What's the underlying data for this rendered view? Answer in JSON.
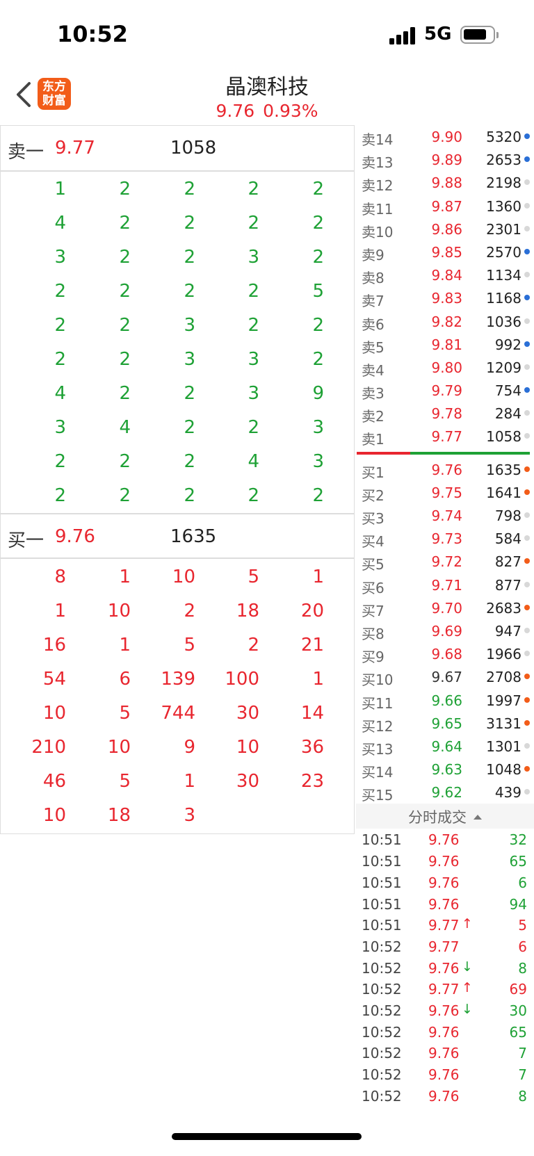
{
  "status": {
    "time": "10:52",
    "network": "5G"
  },
  "header": {
    "logo_line1": "东方",
    "logo_line2": "财富",
    "title": "晶澳科技",
    "price": "9.76",
    "change": "0.93%"
  },
  "ask_panel": {
    "label": "卖一",
    "price": "9.77",
    "volume": "1058",
    "rows": [
      [
        "1",
        "2",
        "2",
        "2",
        "2"
      ],
      [
        "4",
        "2",
        "2",
        "2",
        "2"
      ],
      [
        "3",
        "2",
        "2",
        "3",
        "2"
      ],
      [
        "2",
        "2",
        "2",
        "2",
        "5"
      ],
      [
        "2",
        "2",
        "3",
        "2",
        "2"
      ],
      [
        "2",
        "2",
        "3",
        "3",
        "2"
      ],
      [
        "4",
        "2",
        "2",
        "3",
        "9"
      ],
      [
        "3",
        "4",
        "2",
        "2",
        "3"
      ],
      [
        "2",
        "2",
        "2",
        "4",
        "3"
      ],
      [
        "2",
        "2",
        "2",
        "2",
        "2"
      ]
    ]
  },
  "bid_panel": {
    "label": "买一",
    "price": "9.76",
    "volume": "1635",
    "rows": [
      [
        "8",
        "1",
        "10",
        "5",
        "1"
      ],
      [
        "1",
        "10",
        "2",
        "18",
        "20"
      ],
      [
        "16",
        "1",
        "5",
        "2",
        "21"
      ],
      [
        "54",
        "6",
        "139",
        "100",
        "1"
      ],
      [
        "10",
        "5",
        "744",
        "30",
        "14"
      ],
      [
        "210",
        "10",
        "9",
        "10",
        "36"
      ],
      [
        "46",
        "5",
        "1",
        "30",
        "23"
      ],
      [
        "10",
        "18",
        "3",
        "",
        ""
      ]
    ]
  },
  "order_book": {
    "asks": [
      {
        "label": "卖14",
        "price": "9.90",
        "volume": "5320",
        "price_color": "red",
        "dot": "blue"
      },
      {
        "label": "卖13",
        "price": "9.89",
        "volume": "2653",
        "price_color": "red",
        "dot": "blue"
      },
      {
        "label": "卖12",
        "price": "9.88",
        "volume": "2198",
        "price_color": "red",
        "dot": "gray"
      },
      {
        "label": "卖11",
        "price": "9.87",
        "volume": "1360",
        "price_color": "red",
        "dot": "gray"
      },
      {
        "label": "卖10",
        "price": "9.86",
        "volume": "2301",
        "price_color": "red",
        "dot": "gray"
      },
      {
        "label": "卖9",
        "price": "9.85",
        "volume": "2570",
        "price_color": "red",
        "dot": "blue"
      },
      {
        "label": "卖8",
        "price": "9.84",
        "volume": "1134",
        "price_color": "red",
        "dot": "gray"
      },
      {
        "label": "卖7",
        "price": "9.83",
        "volume": "1168",
        "price_color": "red",
        "dot": "blue"
      },
      {
        "label": "卖6",
        "price": "9.82",
        "volume": "1036",
        "price_color": "red",
        "dot": "gray"
      },
      {
        "label": "卖5",
        "price": "9.81",
        "volume": "992",
        "price_color": "red",
        "dot": "blue"
      },
      {
        "label": "卖4",
        "price": "9.80",
        "volume": "1209",
        "price_color": "red",
        "dot": "gray"
      },
      {
        "label": "卖3",
        "price": "9.79",
        "volume": "754",
        "price_color": "red",
        "dot": "blue"
      },
      {
        "label": "卖2",
        "price": "9.78",
        "volume": "284",
        "price_color": "red",
        "dot": "gray"
      },
      {
        "label": "卖1",
        "price": "9.77",
        "volume": "1058",
        "price_color": "red",
        "dot": "gray"
      }
    ],
    "bids": [
      {
        "label": "买1",
        "price": "9.76",
        "volume": "1635",
        "price_color": "red",
        "dot": "orange"
      },
      {
        "label": "买2",
        "price": "9.75",
        "volume": "1641",
        "price_color": "red",
        "dot": "orange"
      },
      {
        "label": "买3",
        "price": "9.74",
        "volume": "798",
        "price_color": "red",
        "dot": "gray"
      },
      {
        "label": "买4",
        "price": "9.73",
        "volume": "584",
        "price_color": "red",
        "dot": "gray"
      },
      {
        "label": "买5",
        "price": "9.72",
        "volume": "827",
        "price_color": "red",
        "dot": "orange"
      },
      {
        "label": "买6",
        "price": "9.71",
        "volume": "877",
        "price_color": "red",
        "dot": "gray"
      },
      {
        "label": "买7",
        "price": "9.70",
        "volume": "2683",
        "price_color": "red",
        "dot": "orange"
      },
      {
        "label": "买8",
        "price": "9.69",
        "volume": "947",
        "price_color": "red",
        "dot": "gray"
      },
      {
        "label": "买9",
        "price": "9.68",
        "volume": "1966",
        "price_color": "red",
        "dot": "gray"
      },
      {
        "label": "买10",
        "price": "9.67",
        "volume": "2708",
        "price_color": "gray",
        "dot": "orange"
      },
      {
        "label": "买11",
        "price": "9.66",
        "volume": "1997",
        "price_color": "green",
        "dot": "orange"
      },
      {
        "label": "买12",
        "price": "9.65",
        "volume": "3131",
        "price_color": "green",
        "dot": "orange"
      },
      {
        "label": "买13",
        "price": "9.64",
        "volume": "1301",
        "price_color": "green",
        "dot": "gray"
      },
      {
        "label": "买14",
        "price": "9.63",
        "volume": "1048",
        "price_color": "green",
        "dot": "orange"
      },
      {
        "label": "买15",
        "price": "9.62",
        "volume": "439",
        "price_color": "green",
        "dot": "gray"
      }
    ]
  },
  "trades": {
    "title": "分时成交",
    "rows": [
      {
        "time": "10:51",
        "price": "9.76",
        "arrow": "",
        "volume": "32",
        "vol_color": "green"
      },
      {
        "time": "10:51",
        "price": "9.76",
        "arrow": "",
        "volume": "65",
        "vol_color": "green"
      },
      {
        "time": "10:51",
        "price": "9.76",
        "arrow": "",
        "volume": "6",
        "vol_color": "green"
      },
      {
        "time": "10:51",
        "price": "9.76",
        "arrow": "",
        "volume": "94",
        "vol_color": "green"
      },
      {
        "time": "10:51",
        "price": "9.77",
        "arrow": "↑",
        "volume": "5",
        "vol_color": "red"
      },
      {
        "time": "10:52",
        "price": "9.77",
        "arrow": "",
        "volume": "6",
        "vol_color": "red"
      },
      {
        "time": "10:52",
        "price": "9.76",
        "arrow": "↓",
        "volume": "8",
        "vol_color": "green"
      },
      {
        "time": "10:52",
        "price": "9.77",
        "arrow": "↑",
        "volume": "69",
        "vol_color": "red"
      },
      {
        "time": "10:52",
        "price": "9.76",
        "arrow": "↓",
        "volume": "30",
        "vol_color": "green"
      },
      {
        "time": "10:52",
        "price": "9.76",
        "arrow": "",
        "volume": "65",
        "vol_color": "green"
      },
      {
        "time": "10:52",
        "price": "9.76",
        "arrow": "",
        "volume": "7",
        "vol_color": "green"
      },
      {
        "time": "10:52",
        "price": "9.76",
        "arrow": "",
        "volume": "7",
        "vol_color": "green"
      },
      {
        "time": "10:52",
        "price": "9.76",
        "arrow": "",
        "volume": "8",
        "vol_color": "green"
      }
    ]
  },
  "colors": {
    "red": "#e8262f",
    "green": "#1ea135",
    "blue": "#2a6fd6",
    "orange": "#f25c19",
    "gray": "#d8d8d8"
  }
}
